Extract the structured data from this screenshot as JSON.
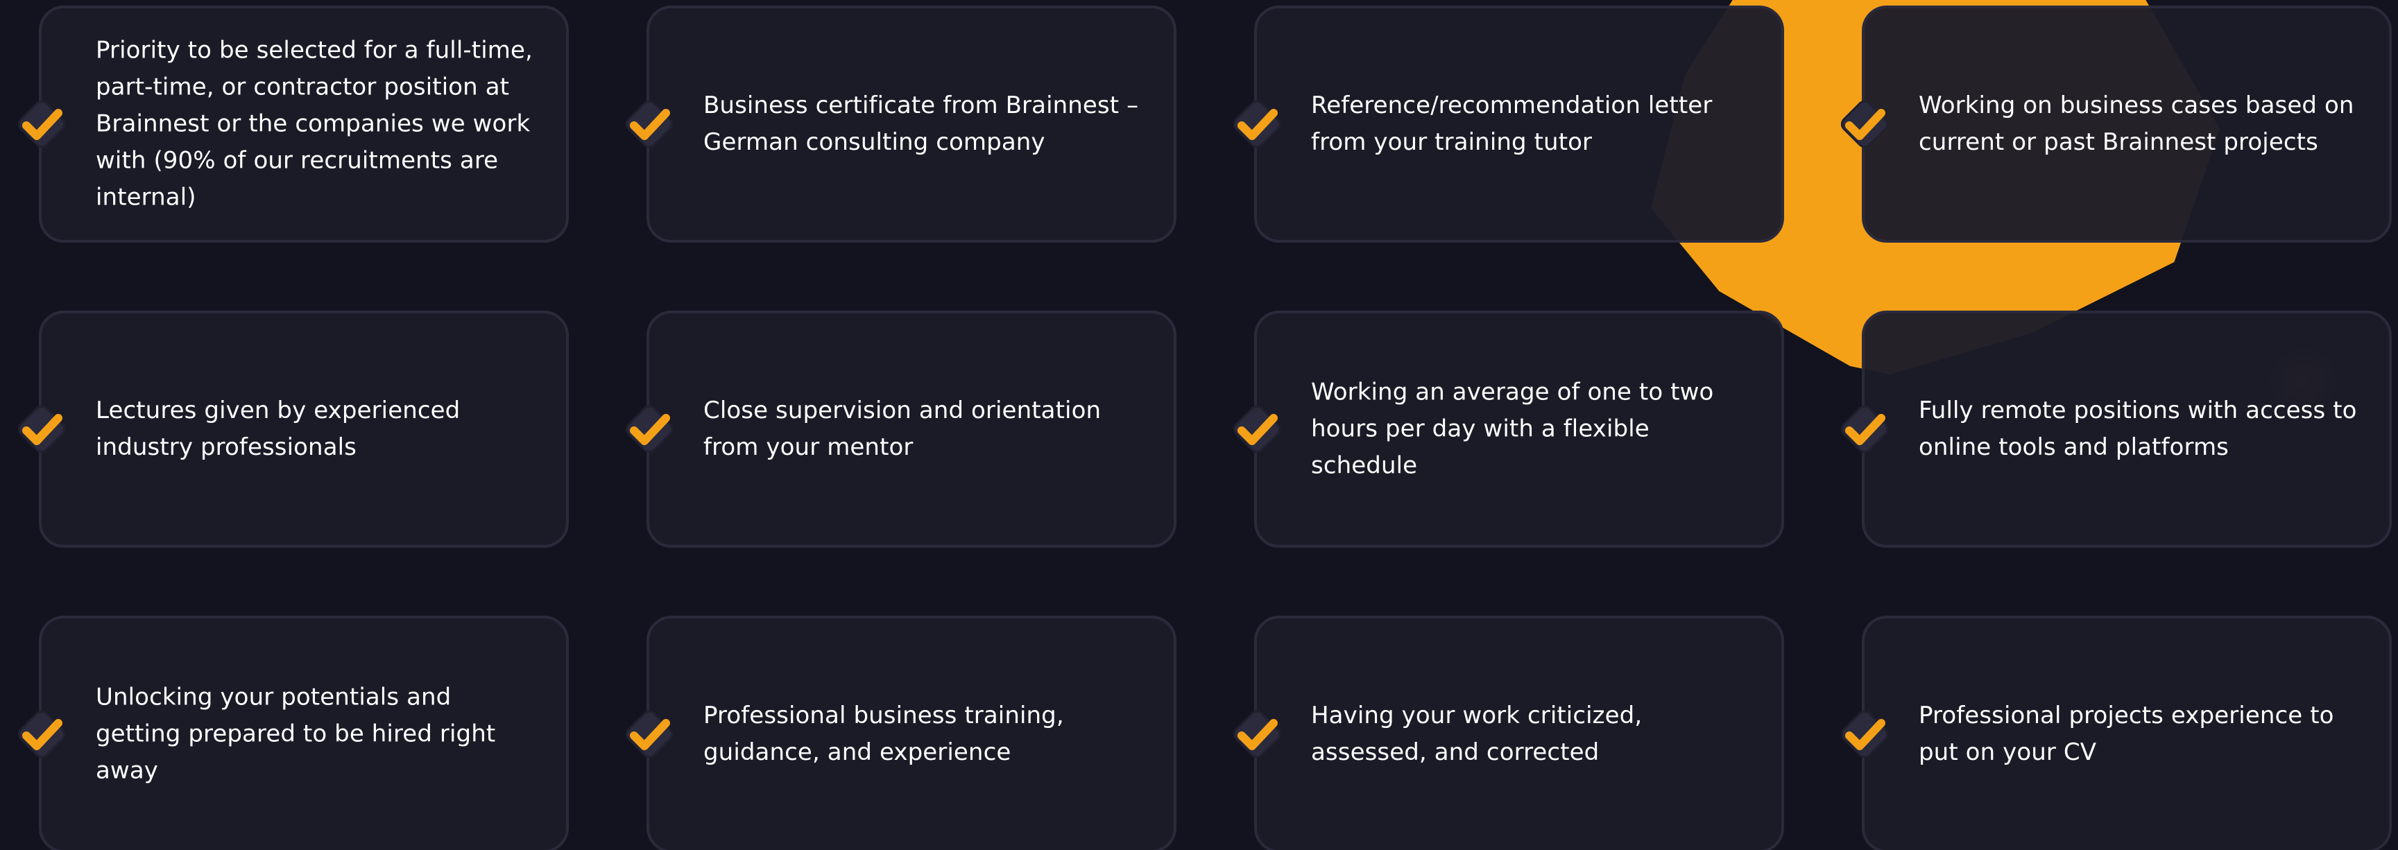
{
  "colors": {
    "background": "#13131f",
    "card_background": "#1c1c29",
    "card_border": "#2a2a3b",
    "accent": "#f5a118",
    "text": "#ffffff"
  },
  "icon": "checkmark-icon",
  "benefits": [
    {
      "text": "Priority to be selected for a full-time, part-time, or contractor position at Brainnest or the companies we work with (90% of our recruitments are internal)"
    },
    {
      "text": "Business certificate from Brainnest – German consulting company"
    },
    {
      "text": "Reference/recommendation letter from your training tutor"
    },
    {
      "text": "Working on business cases based on current or past Brainnest projects"
    },
    {
      "text": "Lectures given by experienced industry professionals"
    },
    {
      "text": "Close supervision and orientation from your mentor"
    },
    {
      "text": "Working an average of one to two hours per day with a flexible schedule"
    },
    {
      "text": "Fully remote positions with access to online tools and platforms"
    },
    {
      "text": "Unlocking your potentials and getting prepared to be hired right away"
    },
    {
      "text": "Professional business training, guidance, and experience"
    },
    {
      "text": "Having your work criticized, assessed, and corrected"
    },
    {
      "text": "Professional projects experience to put on your CV"
    }
  ]
}
